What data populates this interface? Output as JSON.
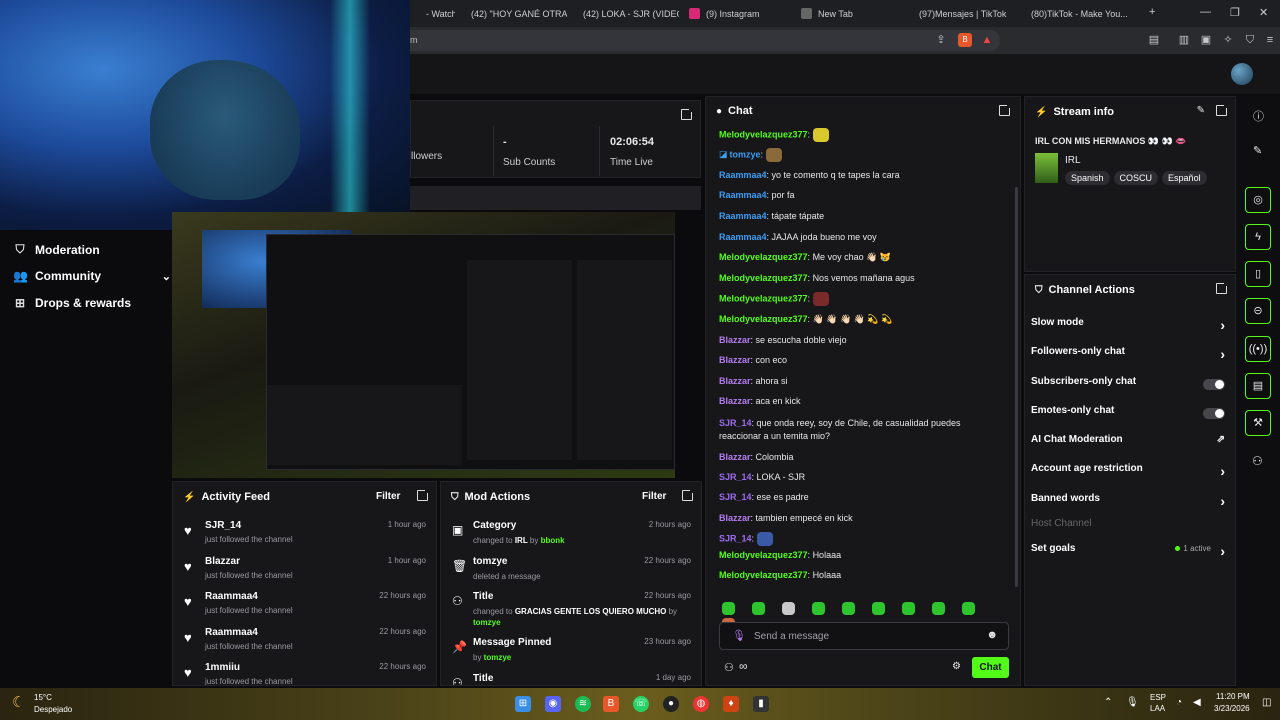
{
  "tabs": [
    {
      "label": "- Watch",
      "icon_color": "#ff0000"
    },
    {
      "label": "(42) \"HOY GANÉ OTRA...",
      "icon_color": "#ff0000"
    },
    {
      "label": "(42) LOKA - SJR (VIDEO...",
      "icon_color": "#ff0000"
    },
    {
      "label": "(9) Instagram",
      "icon_color": "#d62976"
    },
    {
      "label": "New Tab",
      "icon_color": "#666"
    },
    {
      "label": "(97)Mensajes | TikTok",
      "icon_color": "#111"
    },
    {
      "label": "(80)TikTok - Make You...",
      "icon_color": "#111"
    }
  ],
  "url_tail": "m",
  "stats": [
    {
      "value": "",
      "label": "llowers"
    },
    {
      "value": "-",
      "label": "Sub Counts"
    },
    {
      "value": "02:06:54",
      "label": "Time Live"
    }
  ],
  "leftnav": [
    {
      "label": "Moderation",
      "icon": "shield-icon"
    },
    {
      "label": "Community",
      "icon": "community-icon"
    },
    {
      "label": "Drops & rewards",
      "icon": "gift-icon"
    }
  ],
  "activity": {
    "title": "Activity Feed",
    "filter": "Filter",
    "items": [
      {
        "name": "SJR_14",
        "sub": "just followed the channel",
        "time": "1 hour ago"
      },
      {
        "name": "Blazzar",
        "sub": "just followed the channel",
        "time": "1 hour ago"
      },
      {
        "name": "Raammaa4",
        "sub": "just followed the channel",
        "time": "22 hours ago"
      },
      {
        "name": "Raammaa4",
        "sub": "just followed the channel",
        "time": "22 hours ago"
      },
      {
        "name": "1mmiiu",
        "sub": "just followed the channel",
        "time": "22 hours ago"
      }
    ]
  },
  "mod": {
    "title": "Mod Actions",
    "filter": "Filter",
    "items": [
      {
        "name": "Category",
        "pre": "changed to ",
        "hl": "IRL",
        "mid": " by ",
        "user": "bbonk",
        "time": "2 hours ago"
      },
      {
        "name": "tomzye",
        "pre": "deleted a message",
        "hl": "",
        "mid": "",
        "user": "",
        "time": "22 hours ago"
      },
      {
        "name": "Title",
        "pre": "changed to ",
        "hl": "GRACIAS GENTE LOS QUIERO MUCHO",
        "mid": " by ",
        "user": "tomzye",
        "time": "22 hours ago"
      },
      {
        "name": "Message Pinned",
        "pre": "by ",
        "hl": "",
        "mid": "",
        "user": "tomzye",
        "time": "23 hours ago"
      },
      {
        "name": "Title",
        "pre": "",
        "hl": "",
        "mid": "",
        "user": "",
        "time": "1 day ago"
      }
    ]
  },
  "chat": {
    "title": "Chat",
    "messages": [
      {
        "user": "Melodyvelazquez377",
        "cls": "u-g",
        "text": "",
        "emote": true
      },
      {
        "user": "tomzye",
        "cls": "u-b",
        "text": "",
        "emote": true
      },
      {
        "user": "Raammaa4",
        "cls": "u-b",
        "text": "yo te comento q te tapes la cara"
      },
      {
        "user": "Raammaa4",
        "cls": "u-b",
        "text": "por fa"
      },
      {
        "user": "Raammaa4",
        "cls": "u-b",
        "text": "tápate tápate"
      },
      {
        "user": "Raammaa4",
        "cls": "u-b",
        "text": "JAJAA joda bueno me voy"
      },
      {
        "user": "Melodyvelazquez377",
        "cls": "u-g",
        "text": "Me voy chao 👋🏻 😿"
      },
      {
        "user": "Melodyvelazquez377",
        "cls": "u-g",
        "text": "Nos vemos mañana agus"
      },
      {
        "user": "Melodyvelazquez377",
        "cls": "u-g",
        "text": "",
        "emote": true
      },
      {
        "user": "Melodyvelazquez377",
        "cls": "u-g",
        "text": "👋🏻 👋🏻 👋🏻 👋🏻 💫 💫"
      },
      {
        "user": "Blazzar",
        "cls": "u-p",
        "text": "se escucha doble viejo"
      },
      {
        "user": "Blazzar",
        "cls": "u-p",
        "text": "con eco"
      },
      {
        "user": "Blazzar",
        "cls": "u-p",
        "text": "ahora si"
      },
      {
        "user": "Blazzar",
        "cls": "u-p",
        "text": "aca en kick"
      },
      {
        "user": "SJR_14",
        "cls": "u-s",
        "text": "que onda reey, soy de Chile, de casualidad puedes reaccionar a un temita mio?"
      },
      {
        "user": "Blazzar",
        "cls": "u-p",
        "text": "Colombia"
      },
      {
        "user": "SJR_14",
        "cls": "u-s",
        "text": "LOKA - SJR"
      },
      {
        "user": "SJR_14",
        "cls": "u-s",
        "text": "ese es padre"
      },
      {
        "user": "Blazzar",
        "cls": "u-p",
        "text": "tambien empecé en kick"
      },
      {
        "user": "SJR_14",
        "cls": "u-s",
        "text": "",
        "emote": true
      },
      {
        "user": "Melodyvelazquez377",
        "cls": "u-g",
        "text": "Holaaa"
      },
      {
        "user": "Melodyvelazquez377",
        "cls": "u-g",
        "text": "Holaaa"
      }
    ],
    "placeholder": "Send a message",
    "send_label": "Chat"
  },
  "stream": {
    "title": "Stream info",
    "name": "IRL CON MIS HERMANOS 👀 👀 👄",
    "category": "IRL",
    "tags": [
      "Spanish",
      "COSCU",
      "Español"
    ]
  },
  "actions": {
    "title": "Channel Actions",
    "items": [
      {
        "label": "Slow mode",
        "type": "chev"
      },
      {
        "label": "Followers-only chat",
        "type": "chev"
      },
      {
        "label": "Subscribers-only chat",
        "type": "toggle"
      },
      {
        "label": "Emotes-only chat",
        "type": "toggle"
      },
      {
        "label": "AI Chat Moderation",
        "type": "ext"
      },
      {
        "label": "Account age restriction",
        "type": "chev"
      },
      {
        "label": "Banned words",
        "type": "chev"
      },
      {
        "label": "Host Channel",
        "type": "disabled"
      },
      {
        "label": "Set goals",
        "type": "goal",
        "extra": "1 active"
      }
    ]
  },
  "taskbar": {
    "temp": "15°C",
    "weather": "Despejado",
    "lang1": "ESP",
    "lang2": "LAA",
    "time": "11:20 PM",
    "date": "3/23/2026"
  },
  "colors": {
    "accent": "#53fc18",
    "panel": "#17171a",
    "bg": "#0b0b0d"
  }
}
